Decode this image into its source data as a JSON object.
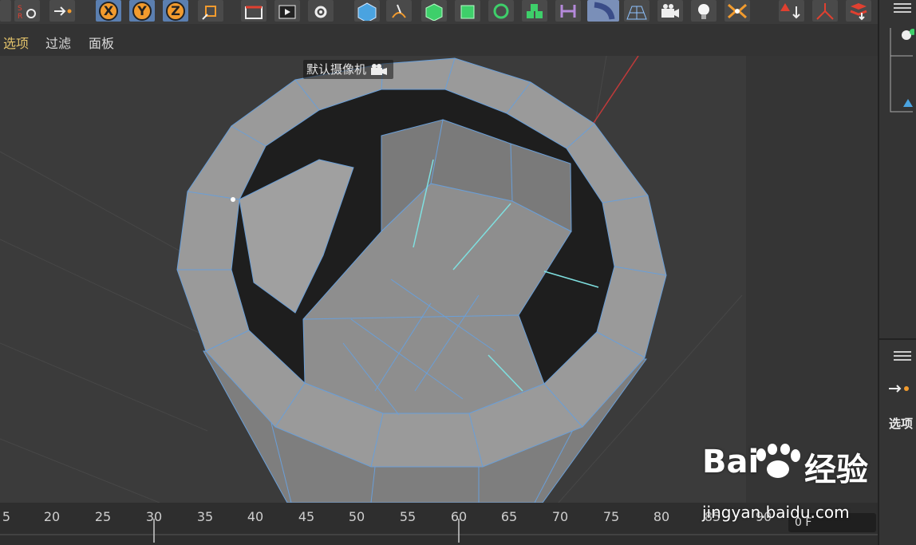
{
  "menubar": {
    "items": [
      {
        "label": "选项"
      },
      {
        "label": "过滤"
      },
      {
        "label": "面板"
      }
    ]
  },
  "viewport": {
    "camera_label": "默认摄像机"
  },
  "toolbar": {
    "axis_buttons": [
      {
        "label": "X"
      },
      {
        "label": "Y"
      },
      {
        "label": "Z"
      }
    ],
    "colors": {
      "bg": "#3a3a3a",
      "axis": "#5b7fb0",
      "button": "#4a4a4a",
      "mesh_edge": "#6a9fd8",
      "selected_edge": "#7fe0e0"
    }
  },
  "timeline": {
    "ticks": [
      "5",
      "20",
      "25",
      "30",
      "35",
      "40",
      "45",
      "50",
      "55",
      "60",
      "65",
      "70",
      "75",
      "80",
      "85",
      "90"
    ],
    "frame_value": "0 F"
  },
  "right_panel": {
    "label": "选项"
  },
  "watermark": {
    "brand": "Bai",
    "brand_cn": "经验",
    "url": "jingyan.baidu.com"
  }
}
